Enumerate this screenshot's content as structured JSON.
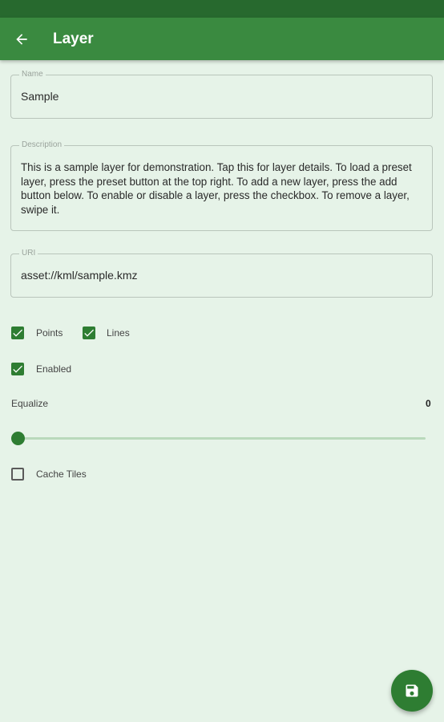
{
  "app_bar": {
    "title": "Layer",
    "back_icon": "arrow-back-icon"
  },
  "form": {
    "name": {
      "label": "Name",
      "value": "Sample"
    },
    "description": {
      "label": "Description",
      "value": "This is a sample layer for demonstration. Tap this for layer details. To load a preset layer, press the preset button at the top right. To add a new layer, press the add button below. To enable or disable a layer, press the checkbox. To remove a layer, swipe it."
    },
    "uri": {
      "label": "URI",
      "value": "asset://kml/sample.kmz"
    }
  },
  "options": {
    "points": {
      "label": "Points",
      "checked": true
    },
    "lines": {
      "label": "Lines",
      "checked": true
    },
    "enabled": {
      "label": "Enabled",
      "checked": true
    },
    "cache_tiles": {
      "label": "Cache Tiles",
      "checked": false
    }
  },
  "equalize": {
    "label": "Equalize",
    "value": "0",
    "slider_fraction": 0
  },
  "fab": {
    "icon": "save-icon"
  },
  "colors": {
    "primary": "#3a8a40",
    "primary_dark": "#27692e",
    "accent": "#2e7d32",
    "background": "#e6f3e8"
  }
}
